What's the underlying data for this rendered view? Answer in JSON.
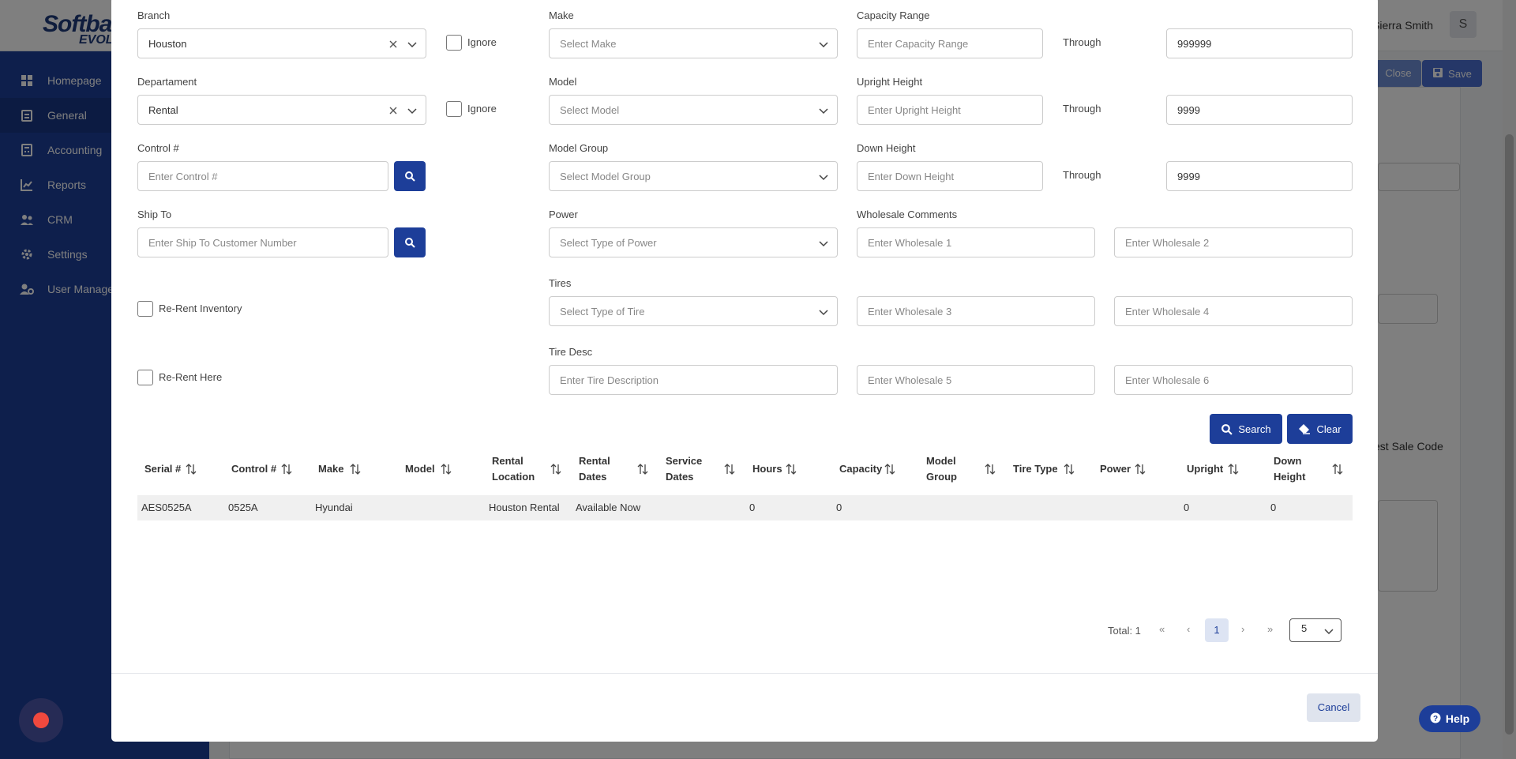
{
  "app": {
    "brand_top": "Softba",
    "brand_bottom": "EVOL",
    "user_name": "Sierra Smith",
    "user_initial": "S",
    "close_label": "Close",
    "save_label": "Save",
    "help_label": "Help",
    "bg_snippet": "est Sale Code"
  },
  "sidebar": {
    "items": [
      {
        "label": "Homepage",
        "icon": "home-grid-icon"
      },
      {
        "label": "General",
        "icon": "clipboard-icon"
      },
      {
        "label": "Accounting",
        "icon": "calculator-icon"
      },
      {
        "label": "Reports",
        "icon": "chart-icon"
      },
      {
        "label": "CRM",
        "icon": "users-icon"
      },
      {
        "label": "Settings",
        "icon": "gear-icon"
      },
      {
        "label": "User Manager",
        "icon": "user-gear-icon"
      }
    ]
  },
  "modal": {
    "branch": {
      "label": "Branch",
      "value": "Houston",
      "ignore_label": "Ignore"
    },
    "department": {
      "label": "Departament",
      "value": "Rental",
      "ignore_label": "Ignore"
    },
    "control": {
      "label": "Control #",
      "placeholder": "Enter Control #"
    },
    "ship_to": {
      "label": "Ship To",
      "placeholder": "Enter Ship To Customer Number"
    },
    "re_rent_inventory": "Re-Rent Inventory",
    "re_rent_here": "Re-Rent Here",
    "make": {
      "label": "Make",
      "placeholder": "Select Make"
    },
    "model": {
      "label": "Model",
      "placeholder": "Select Model"
    },
    "model_group": {
      "label": "Model Group",
      "placeholder": "Select Model Group"
    },
    "power": {
      "label": "Power",
      "placeholder": "Select Type of Power"
    },
    "tires": {
      "label": "Tires",
      "placeholder": "Select Type of Tire"
    },
    "tire_desc": {
      "label": "Tire Desc",
      "placeholder": "Enter Tire Description"
    },
    "capacity": {
      "label": "Capacity Range",
      "placeholder": "Enter Capacity Range",
      "through": "Through",
      "through_value": "999999"
    },
    "upright": {
      "label": "Upright Height",
      "placeholder": "Enter Upright Height",
      "through": "Through",
      "through_value": "9999"
    },
    "down": {
      "label": "Down Height",
      "placeholder": "Enter Down Height",
      "through": "Through",
      "through_value": "9999"
    },
    "wholesale": {
      "label": "Wholesale Comments",
      "placeholders": [
        "Enter Wholesale 1",
        "Enter Wholesale 2",
        "Enter Wholesale 3",
        "Enter Wholesale 4",
        "Enter Wholesale 5",
        "Enter Wholesale 6"
      ]
    },
    "search_label": "Search",
    "clear_label": "Clear",
    "table": {
      "headers": [
        {
          "l1": "Serial #",
          "l2": ""
        },
        {
          "l1": "Control #",
          "l2": ""
        },
        {
          "l1": "Make",
          "l2": ""
        },
        {
          "l1": "Model",
          "l2": ""
        },
        {
          "l1": "Rental",
          "l2": "Location"
        },
        {
          "l1": "Rental",
          "l2": "Dates"
        },
        {
          "l1": "Service",
          "l2": "Dates"
        },
        {
          "l1": "Hours",
          "l2": ""
        },
        {
          "l1": "Capacity",
          "l2": ""
        },
        {
          "l1": "Model",
          "l2": "Group"
        },
        {
          "l1": "Tire Type",
          "l2": ""
        },
        {
          "l1": "Power",
          "l2": ""
        },
        {
          "l1": "Upright",
          "l2": ""
        },
        {
          "l1": "Down",
          "l2": "Height"
        }
      ],
      "rows": [
        {
          "serial": "AES0525A",
          "control": "0525A",
          "make": "Hyundai",
          "model": "",
          "rental_location": "Houston Rental",
          "rental_dates": "Available Now",
          "service_dates": "",
          "hours": "0",
          "capacity": "0",
          "model_group": "",
          "tire_type": "",
          "power": "",
          "upright": "0",
          "down_height": "0"
        }
      ]
    },
    "pager": {
      "total": "Total: 1",
      "first": "«",
      "prev": "‹",
      "current": "1",
      "next": "›",
      "last": "»",
      "page_size": "5"
    },
    "cancel_label": "Cancel"
  },
  "colors": {
    "primary": "#1d3e99",
    "overlay": "rgba(0,0,0,0.5)"
  }
}
